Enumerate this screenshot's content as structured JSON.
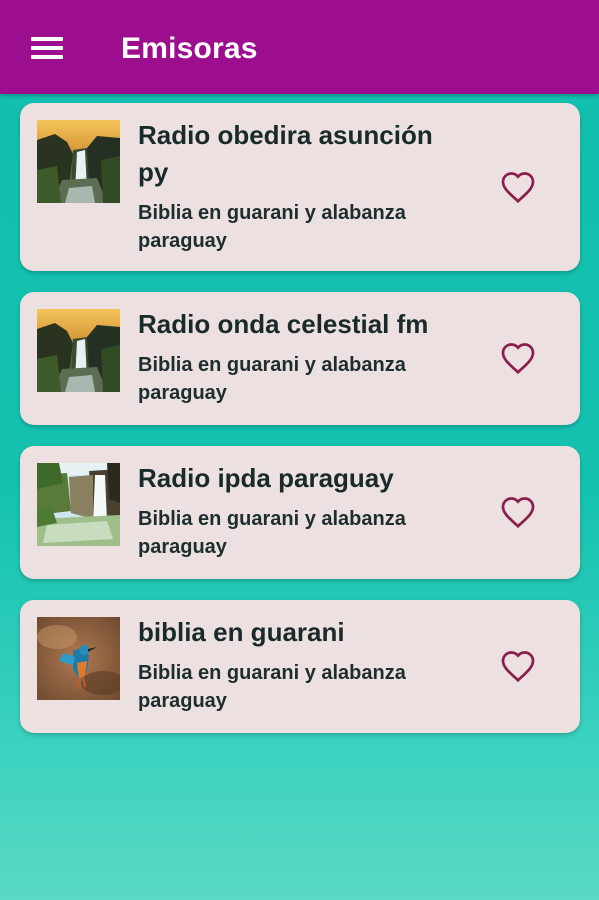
{
  "appbar": {
    "title": "Emisoras",
    "menu_icon": "hamburger-menu-icon"
  },
  "stations": [
    {
      "name": "Radio obedira asunción py",
      "description": "Biblia en guarani y alabanza paraguay",
      "thumbnail": "waterfall-sunset-image",
      "favorite_icon": "heart-outline-icon"
    },
    {
      "name": "Radio onda celestial fm",
      "description": "Biblia en guarani y alabanza paraguay",
      "thumbnail": "waterfall-sunset-image",
      "favorite_icon": "heart-outline-icon"
    },
    {
      "name": "Radio ipda paraguay",
      "description": "Biblia en guarani y alabanza paraguay",
      "thumbnail": "waterfall-pool-image",
      "favorite_icon": "heart-outline-icon"
    },
    {
      "name": "biblia en guarani",
      "description": "Biblia en guarani y alabanza paraguay",
      "thumbnail": "kingfisher-bird-image",
      "favorite_icon": "heart-outline-icon"
    }
  ],
  "colors": {
    "appbar": "#9c0e8e",
    "card": "#ece0e0",
    "heart": "#8a1f4e",
    "background": "#12bfb0"
  }
}
